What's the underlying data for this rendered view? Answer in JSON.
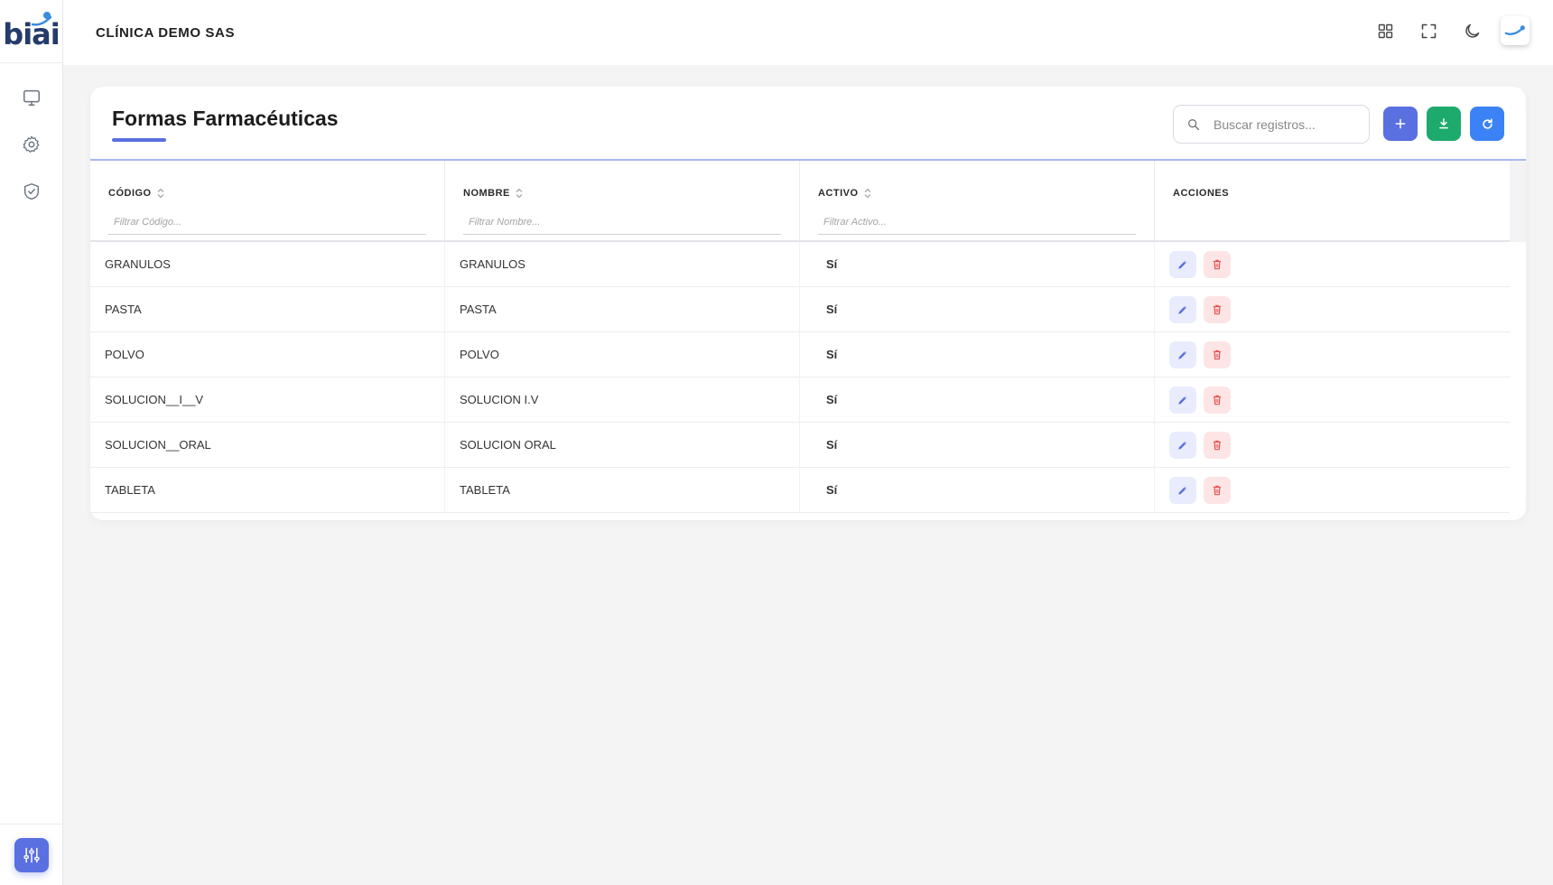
{
  "app": {
    "logo_text": "biai",
    "company": "CLÍNICA DEMO SAS"
  },
  "sidebar": {
    "items": [
      {
        "name": "monitor-icon"
      },
      {
        "name": "gear-icon"
      },
      {
        "name": "shield-check-icon"
      }
    ],
    "bottom_icon": "sliders-icon"
  },
  "header": {
    "icons": [
      "grid-icon",
      "fullscreen-icon",
      "moon-icon",
      "avatar"
    ]
  },
  "page": {
    "title": "Formas Farmacéuticas",
    "search_placeholder": "Buscar registros...",
    "buttons": {
      "add": "plus-icon",
      "download": "download-icon",
      "refresh": "refresh-icon"
    }
  },
  "table": {
    "columns": [
      {
        "label": "CÓDIGO",
        "sortable": true,
        "filter_placeholder": "Filtrar Código..."
      },
      {
        "label": "NOMBRE",
        "sortable": true,
        "filter_placeholder": "Filtrar Nombre..."
      },
      {
        "label": "ACTIVO",
        "sortable": true,
        "filter_placeholder": "Filtrar Activo..."
      },
      {
        "label": "ACCIONES",
        "sortable": false,
        "filter_placeholder": ""
      }
    ],
    "rows": [
      {
        "codigo": "GRANULOS",
        "nombre": "GRANULOS",
        "activo": "Sí"
      },
      {
        "codigo": "PASTA",
        "nombre": "PASTA",
        "activo": "Sí"
      },
      {
        "codigo": "POLVO",
        "nombre": "POLVO",
        "activo": "Sí"
      },
      {
        "codigo": "SOLUCION__I__V",
        "nombre": "SOLUCION I.V",
        "activo": "Sí"
      },
      {
        "codigo": "SOLUCION__ORAL",
        "nombre": "SOLUCION ORAL",
        "activo": "Sí"
      },
      {
        "codigo": "TABLETA",
        "nombre": "TABLETA",
        "activo": "Sí"
      }
    ]
  },
  "colors": {
    "primary": "#5a6fe0",
    "success": "#1cab6c",
    "info": "#3b82f6",
    "danger": "#e55353"
  }
}
